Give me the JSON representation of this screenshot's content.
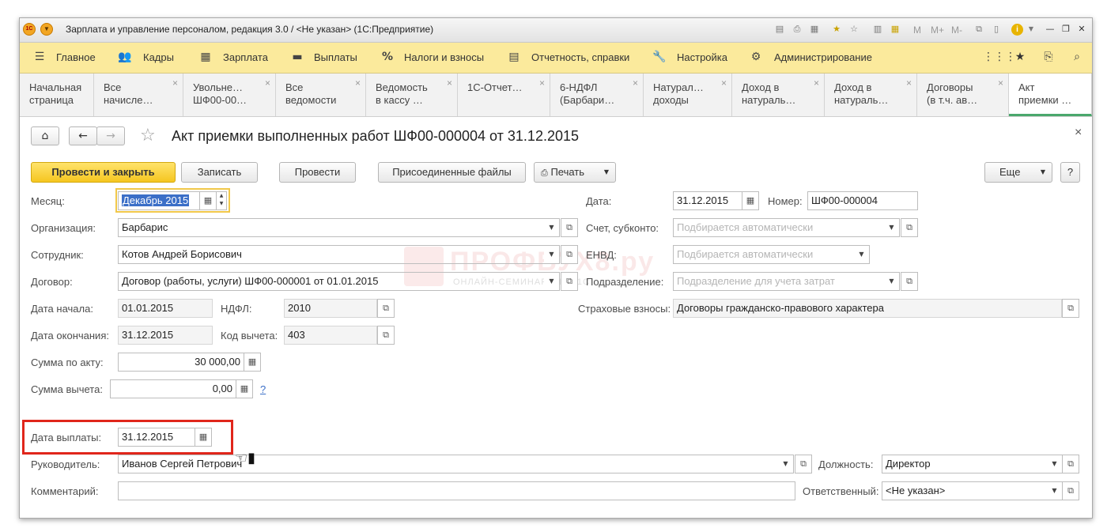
{
  "window": {
    "title": "Зарплата и управление персоналом, редакция 3.0 / <Не указан>  (1С:Предприятие)",
    "right_labels": {
      "m": "M",
      "m_plus": "M+",
      "m_minus": "M-"
    }
  },
  "menu": {
    "items": [
      {
        "label": "Главное",
        "icon": "hamburger-icon"
      },
      {
        "label": "Кадры",
        "icon": "people-icon"
      },
      {
        "label": "Зарплата",
        "icon": "calculator-icon"
      },
      {
        "label": "Выплаты",
        "icon": "wallet-icon"
      },
      {
        "label": "Налоги и взносы",
        "icon": "percent-icon"
      },
      {
        "label": "Отчетность, справки",
        "icon": "reports-icon"
      },
      {
        "label": "Настройка",
        "icon": "wrench-icon"
      },
      {
        "label": "Администрирование",
        "icon": "gear-icon"
      }
    ]
  },
  "tabs": [
    {
      "label": "Начальная\nстраница",
      "closable": false
    },
    {
      "label": "Все\nначисле…",
      "closable": true
    },
    {
      "label": "Увольне…\nШФ00-00…",
      "closable": true
    },
    {
      "label": "Все\nведомости",
      "closable": true
    },
    {
      "label": "Ведомость\nв кассу …",
      "closable": true
    },
    {
      "label": "1С-Отчет…",
      "closable": true
    },
    {
      "label": "6-НДФЛ\n(Барбари…",
      "closable": true
    },
    {
      "label": "Натурал…\nдоходы",
      "closable": true
    },
    {
      "label": "Доход в\nнатураль…",
      "closable": true
    },
    {
      "label": "Доход в\nнатураль…",
      "closable": true
    },
    {
      "label": "Договоры\n(в т.ч. ав…",
      "closable": true
    },
    {
      "label": "Акт\nприемки …",
      "closable": false
    }
  ],
  "document": {
    "title": "Акт приемки выполненных работ ШФ00-000004 от 31.12.2015",
    "close": "×"
  },
  "toolbar": {
    "post_close": "Провести и закрыть",
    "save": "Записать",
    "post": "Провести",
    "attached_files": "Присоединенные файлы",
    "print": "Печать",
    "more": "Еще",
    "help": "?"
  },
  "form": {
    "month": {
      "label": "Месяц:",
      "value": "Декабрь 2015"
    },
    "date": {
      "label": "Дата:",
      "value": "31.12.2015"
    },
    "number": {
      "label": "Номер:",
      "value": "ШФ00-000004"
    },
    "organization": {
      "label": "Организация:",
      "value": "Барбарис"
    },
    "account": {
      "label": "Счет, субконто:",
      "placeholder": "Подбирается автоматически"
    },
    "employee": {
      "label": "Сотрудник:",
      "value": "Котов Андрей Борисович"
    },
    "envd": {
      "label": "ЕНВД:",
      "placeholder": "Подбирается автоматически"
    },
    "contract": {
      "label": "Договор:",
      "value": "Договор (работы, услуги) ШФ00-000001 от 01.01.2015"
    },
    "department": {
      "label": "Подразделение:",
      "placeholder": "Подразделение для учета затрат"
    },
    "start_date": {
      "label": "Дата начала:",
      "value": "01.01.2015"
    },
    "ndfl": {
      "label": "НДФЛ:",
      "value": "2010"
    },
    "insurance": {
      "label": "Страховые взносы:",
      "value": "Договоры гражданско-правового характера"
    },
    "end_date": {
      "label": "Дата окончания:",
      "value": "31.12.2015"
    },
    "deduction_code": {
      "label": "Код вычета:",
      "value": "403"
    },
    "act_sum": {
      "label": "Сумма по акту:",
      "value": "30 000,00"
    },
    "deduction_sum": {
      "label": "Сумма вычета:",
      "value": "0,00",
      "hint": "?"
    },
    "payment_date": {
      "label": "Дата выплаты:",
      "value": "31.12.2015"
    },
    "manager": {
      "label": "Руководитель:",
      "value": "Иванов Сергей Петрович"
    },
    "position": {
      "label": "Должность:",
      "value": "Директор"
    },
    "comment": {
      "label": "Комментарий:",
      "value": ""
    },
    "responsible": {
      "label": "Ответственный:",
      "value": "<Не указан>"
    }
  },
  "watermark": {
    "main": "ПРОФБУХ8.ру",
    "sub": "ОНЛАЙН-СЕМИНАРЫ ПО 1С"
  },
  "highlight_color": "#e0261b",
  "accent_color": "#fbea9c"
}
